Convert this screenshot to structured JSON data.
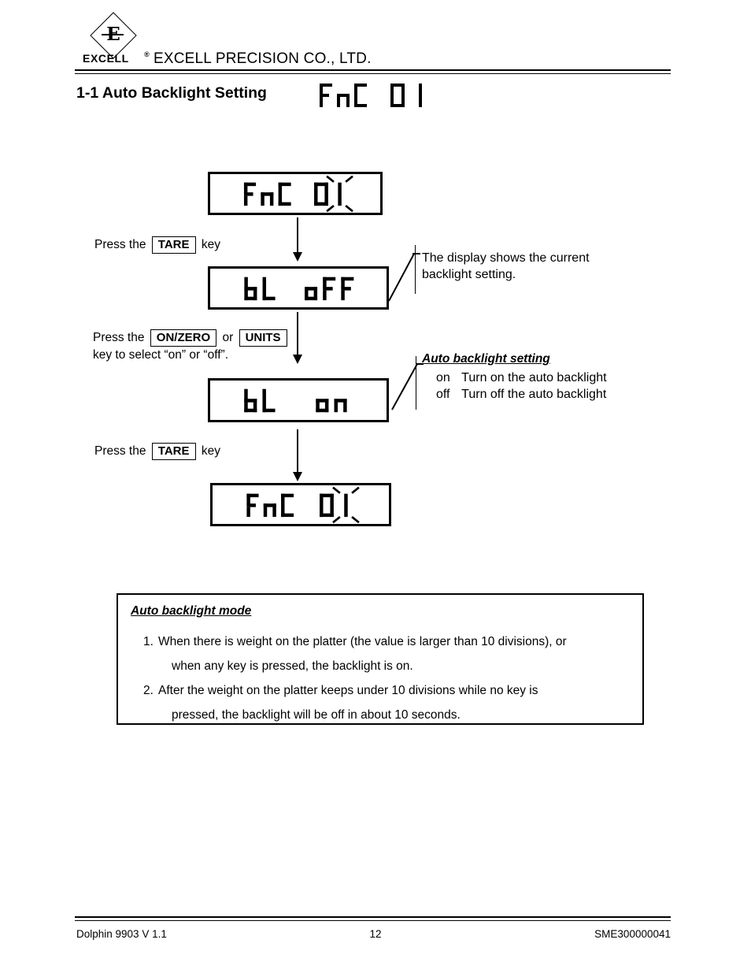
{
  "header": {
    "logo_word": "EXCELL",
    "logo_superscript": "®",
    "logo_mark_letter": "E",
    "company_name": "EXCELL PRECISION CO., LTD."
  },
  "title": {
    "number_and_text": "1-1 Auto Backlight Setting",
    "segment_display": "FnC 01"
  },
  "flow": {
    "displays": [
      {
        "id": "display-1",
        "text": "FnC 01",
        "blinking": true,
        "blink_target": "1"
      },
      {
        "id": "display-2",
        "text": "bL oFF",
        "blinking": false,
        "blink_target": ""
      },
      {
        "id": "display-3",
        "text": "bL on",
        "blinking": false,
        "blink_target": ""
      },
      {
        "id": "display-4",
        "text": "FnC 01",
        "blinking": true,
        "blink_target": "1"
      }
    ],
    "steps": [
      {
        "id": "step-1",
        "prefix": "Press the",
        "keys": [
          "TARE"
        ],
        "separator": "",
        "suffix": "key",
        "second_line": ""
      },
      {
        "id": "step-2",
        "prefix": "Press the",
        "keys": [
          "ON/ZERO",
          "UNITS"
        ],
        "separator": "or",
        "suffix": "",
        "second_line": "key to select “on” or “off”."
      },
      {
        "id": "step-3",
        "prefix": "Press the",
        "keys": [
          "TARE"
        ],
        "separator": "",
        "suffix": "key",
        "second_line": ""
      }
    ]
  },
  "callouts": {
    "first": {
      "line1": "The display shows the current",
      "line2": "backlight setting."
    },
    "second": {
      "title": "Auto backlight setting",
      "rows": [
        {
          "key": "on",
          "desc": "Turn on the auto backlight"
        },
        {
          "key": "off",
          "desc": "Turn off the auto backlight"
        }
      ]
    }
  },
  "note_box": {
    "title": "Auto backlight mode",
    "items": [
      {
        "number": "1.",
        "line1": "When there is weight on the platter (the value is larger than 10 divisions), or",
        "line2": "when any key is pressed, the backlight is on."
      },
      {
        "number": "2.",
        "line1": "After the weight on the platter keeps under 10 divisions while no key is",
        "line2": "pressed, the backlight will be off in about 10 seconds."
      }
    ]
  },
  "footer": {
    "left": "Dolphin 9903 V 1.1",
    "center": "12",
    "right": "SME300000041"
  },
  "colors": {
    "ink": "#000000",
    "paper": "#ffffff"
  }
}
